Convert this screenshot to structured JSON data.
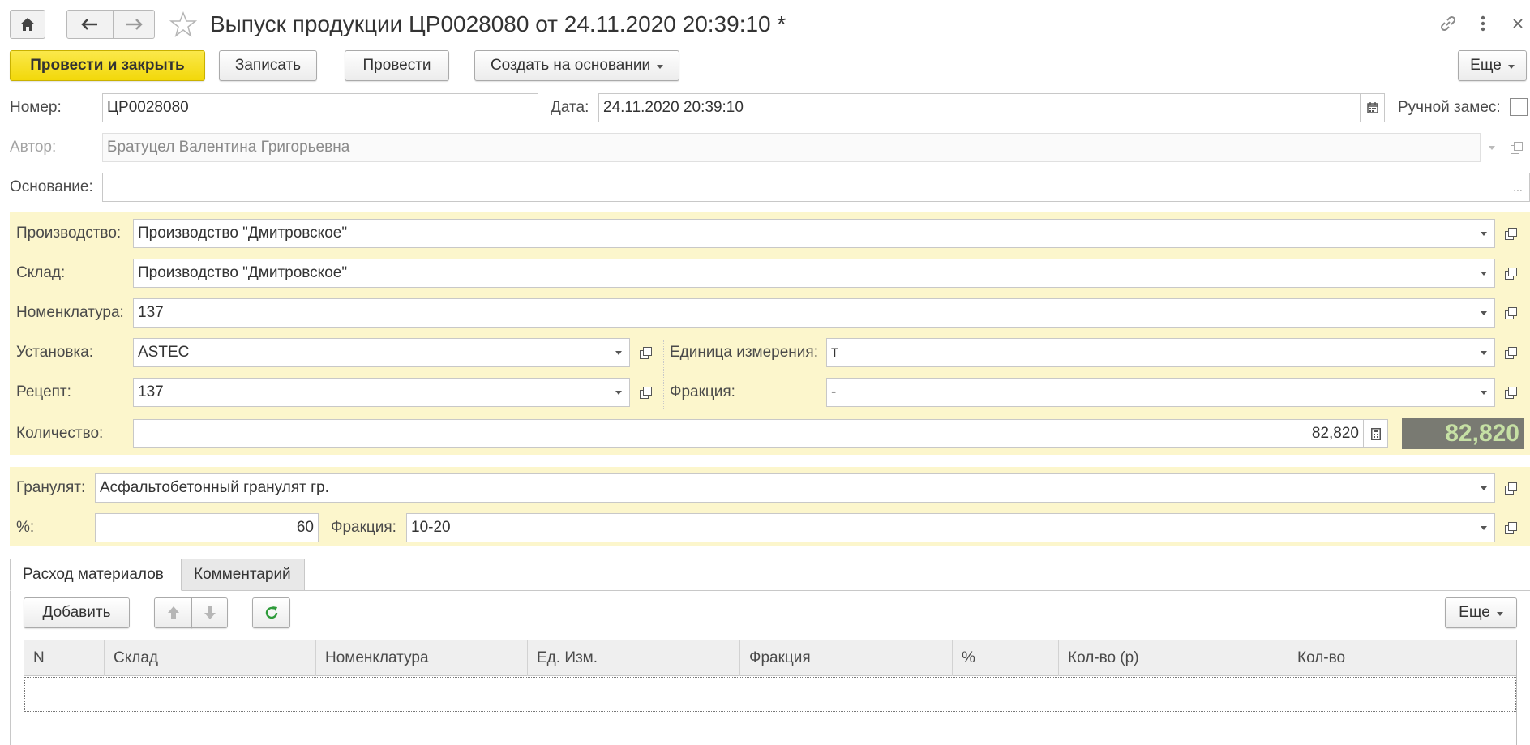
{
  "titlebar": {
    "title": "Выпуск продукции ЦР0028080 от 24.11.2020 20:39:10 *",
    "home_icon": "home-icon",
    "back_icon": "arrow-left-icon",
    "forward_icon": "arrow-right-icon",
    "favorite_icon": "star-icon",
    "link_icon": "link-icon",
    "menu_icon": "more-vertical-icon",
    "close_icon": "close-icon"
  },
  "toolbar": {
    "post_close": "Провести и закрыть",
    "save": "Записать",
    "post": "Провести",
    "create_based": "Создать на основании",
    "more": "Еще"
  },
  "header": {
    "number_label": "Номер:",
    "number_value": "ЦР0028080",
    "date_label": "Дата:",
    "date_value": "24.11.2020 20:39:10",
    "manual_label": "Ручной замес:",
    "manual_checked": false,
    "author_label": "Автор:",
    "author_value": "Братуцел Валентина Григорьевна",
    "basis_label": "Основание:",
    "basis_value": "",
    "basis_btn": "..."
  },
  "production": {
    "production_label": "Производство:",
    "production_value": "Производство \"Дмитровское\"",
    "warehouse_label": "Склад:",
    "warehouse_value": "Производство \"Дмитровское\"",
    "nomenclature_label": "Номенклатура:",
    "nomenclature_value": "137",
    "plant_label": "Установка:",
    "plant_value": "ASTEC",
    "unit_label": "Единица измерения:",
    "unit_value": "т",
    "recipe_label": "Рецепт:",
    "recipe_value": "137",
    "fraction_label": "Фракция:",
    "fraction_value": "-",
    "quantity_label": "Количество:",
    "quantity_value": "82,820",
    "quantity_display": "82,820"
  },
  "granulate": {
    "granulate_label": "Гранулят:",
    "granulate_value": "Асфальтобетонный гранулят гр.",
    "percent_label": "%:",
    "percent_value": "60",
    "fraction_label": "Фракция:",
    "fraction_value": "10-20"
  },
  "tabs": [
    {
      "label": "Расход материалов",
      "active": true
    },
    {
      "label": "Комментарий",
      "active": false
    }
  ],
  "table_toolbar": {
    "add": "Добавить",
    "more": "Еще"
  },
  "table": {
    "columns": [
      "N",
      "Склад",
      "Номенклатура",
      "Ед. Изм.",
      "Фракция",
      "%",
      "Кол-во (р)",
      "Кол-во"
    ],
    "rows": []
  },
  "colors": {
    "accent_yellow": "#f5dc1e",
    "section_bg": "#fcf6cc",
    "quantity_bg": "#797a72",
    "quantity_fg": "#c6e0a4"
  }
}
